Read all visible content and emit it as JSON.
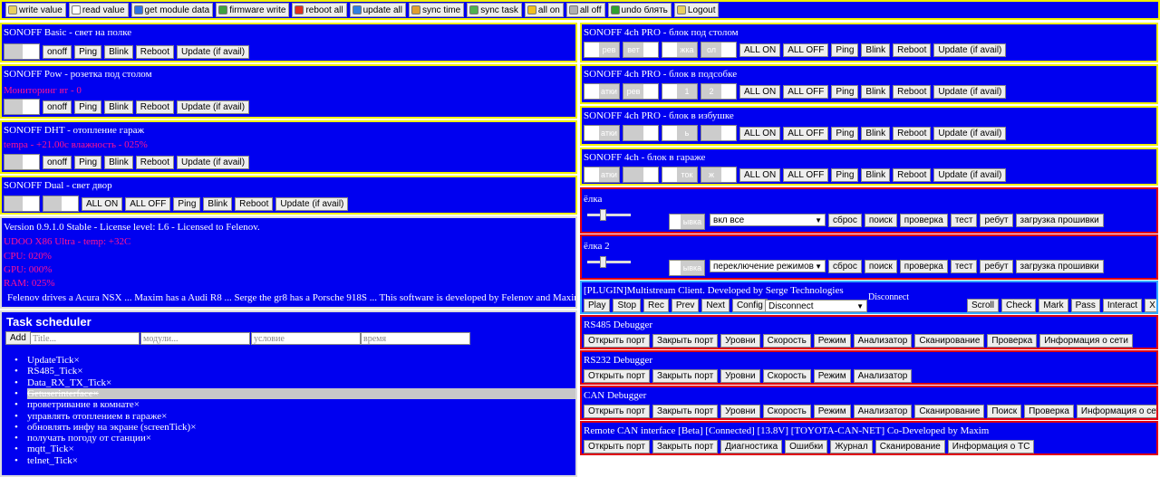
{
  "toolbar": {
    "buttons": [
      {
        "label": "write value",
        "icon": "pencil-icon",
        "color": "#e8d060"
      },
      {
        "label": "read value",
        "icon": "doc-icon",
        "color": "#ffffff"
      },
      {
        "label": "get module data",
        "icon": "info-icon",
        "color": "#3070e0"
      },
      {
        "label": "firmware write",
        "icon": "chip-icon",
        "color": "#40a040"
      },
      {
        "label": "reboot all",
        "icon": "power-icon",
        "color": "#e03020"
      },
      {
        "label": "update all",
        "icon": "update-icon",
        "color": "#3080e0"
      },
      {
        "label": "sync time",
        "icon": "clock-icon",
        "color": "#e0a030"
      },
      {
        "label": "sync task",
        "icon": "task-icon",
        "color": "#50b050"
      },
      {
        "label": "all on",
        "icon": "bulb-on-icon",
        "color": "#f0c020"
      },
      {
        "label": "all off",
        "icon": "bulb-off-icon",
        "color": "#b0b0b0"
      },
      {
        "label": "undo блять",
        "icon": "undo-icon",
        "color": "#30a030"
      },
      {
        "label": "Logout",
        "icon": "logout-icon",
        "color": "#e8d060"
      }
    ]
  },
  "left": {
    "basic": {
      "title": "SONOFF Basic - свет на полке",
      "buttons": [
        "onoff",
        "Ping",
        "Blink",
        "Reboot",
        "Update (if avail)"
      ]
    },
    "pow": {
      "title": "SONOFF Pow - розетка под столом",
      "status": "Мониторинг вт - 0",
      "buttons": [
        "onoff",
        "Ping",
        "Blink",
        "Reboot",
        "Update (if avail)"
      ]
    },
    "dht": {
      "title": "SONOFF DHT - отопление гараж",
      "status": "tempa - +21.00c влажность - 025%",
      "buttons": [
        "onoff",
        "Ping",
        "Blink",
        "Reboot",
        "Update (if avail)"
      ]
    },
    "dual": {
      "title": "SONOFF Dual - свет двор",
      "buttons": [
        "ALL ON",
        "ALL OFF",
        "Ping",
        "Blink",
        "Reboot",
        "Update (if avail)"
      ]
    },
    "info": {
      "version": "Version 0.9.1.0 Stable - License level: L6 - Licensed to Felenov.",
      "host": "UDOO X86 Ultra - temp: +32C",
      "cpu": "CPU: 020%",
      "gpu": "GPU: 000%",
      "ram": "RAM: 025%",
      "marquee": "Felenov drives a Acura NSX ... Maxim has a Audi R8 ... Serge the gr8 has a Porsche 918S ... This software is developed by Felenov and Maxim"
    },
    "tasks": {
      "title": "Task scheduler",
      "add": "Add",
      "placeholders": [
        "Title...",
        "модули...",
        "условие",
        "время"
      ],
      "items": [
        "UpdateTick×",
        "RS485_Tick×",
        "Data_RX_TX_Tick×",
        "Getuserinterface×",
        "проветривание в комнате×",
        "управлять отоплением в гараже×",
        "обновлять инфу на экране (screenTick)×",
        "получать погоду от станции×",
        "mqtt_Tick×",
        "telnet_Tick×"
      ]
    }
  },
  "right": {
    "ch4": [
      {
        "title": "SONOFF 4ch PRO - блок под столом",
        "toggles": [
          "рев",
          "вет",
          "жка",
          "ол"
        ]
      },
      {
        "title": "SONOFF 4ch PRO - блок в подсобке",
        "toggles": [
          "атки",
          "рев",
          "1",
          "2"
        ]
      },
      {
        "title": "SONOFF 4ch PRO - блок в избушке",
        "toggles": [
          "атки",
          "",
          "ь",
          ""
        ]
      },
      {
        "title": "SONOFF 4ch - блок в гараже",
        "toggles": [
          "атки",
          "",
          "ток",
          "ж"
        ]
      }
    ],
    "ch4_buttons": [
      "ALL ON",
      "ALL OFF",
      "Ping",
      "Blink",
      "Reboot",
      "Update (if avail)"
    ],
    "elka1": {
      "title": "ёлка",
      "toggle": "ывка",
      "select": "вкл все",
      "buttons": [
        "сброс",
        "поиск",
        "проверка",
        "тест",
        "ребут",
        "загрузка прошивки"
      ]
    },
    "elka2": {
      "title": "ёлка 2",
      "toggle": "ывка",
      "select": "переключение режимов",
      "buttons": [
        "сброс",
        "поиск",
        "проверка",
        "тест",
        "ребут",
        "загрузка прошивки"
      ]
    },
    "plugin": {
      "title": "[PLUGIN]Multistream Client. Developed by Serge Technologies",
      "status": "Disconnect",
      "left_buttons": [
        "Play",
        "Stop",
        "Rec",
        "Prev",
        "Next",
        "Config"
      ],
      "select": "Disconnect",
      "right_buttons": [
        "Scroll",
        "Check",
        "Mark",
        "Pass",
        "Interact",
        "X"
      ]
    },
    "rs485": {
      "title": "RS485 Debugger",
      "buttons": [
        "Открыть порт",
        "Закрыть порт",
        "Уровни",
        "Скорость",
        "Режим",
        "Анализатор",
        "Сканирование",
        "Проверка",
        "Информация о сети"
      ]
    },
    "rs232": {
      "title": "RS232 Debugger",
      "buttons": [
        "Открыть порт",
        "Закрыть порт",
        "Уровни",
        "Скорость",
        "Режим",
        "Анализатор"
      ]
    },
    "can": {
      "title": "CAN Debugger",
      "buttons": [
        "Открыть порт",
        "Закрыть порт",
        "Уровни",
        "Скорость",
        "Режим",
        "Анализатор",
        "Сканирование",
        "Поиск",
        "Проверка",
        "Информация о сети"
      ]
    },
    "remote": {
      "title": "Remote CAN interface [Beta] [Connected] [13.8V] [TOYOTA-CAN-NET] Co-Developed by Maxim",
      "buttons": [
        "Открыть порт",
        "Закрыть порт",
        "Диагностика",
        "Ошибки",
        "Журнал",
        "Сканирование",
        "Информация о ТС"
      ]
    }
  }
}
